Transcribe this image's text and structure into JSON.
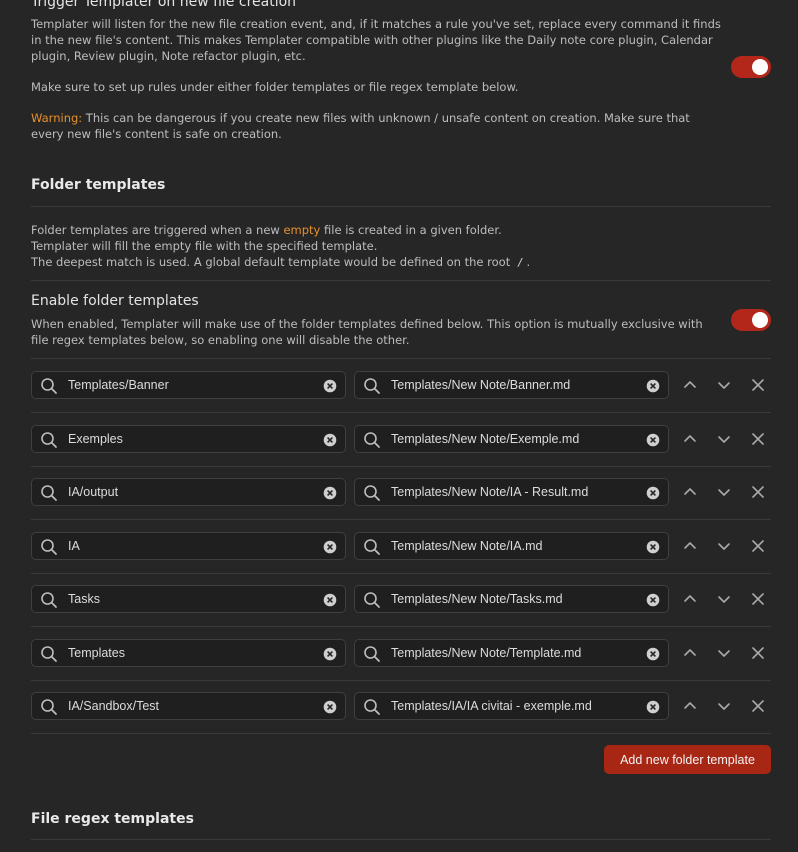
{
  "trigger": {
    "title": "Trigger Templater on new file creation",
    "desc1": "Templater will listen for the new file creation event, and, if it matches a rule you've set, replace every command it finds in the new file's content. This makes Templater compatible with other plugins like the Daily note core plugin, Calendar plugin, Review plugin, Note refactor plugin, etc.",
    "desc2": "Make sure to set up rules under either folder templates or file regex template below.",
    "warning_label": "Warning:",
    "warning_text": " This can be dangerous if you create new files with unknown / unsafe content on creation. Make sure that every new file's content is safe on creation.",
    "enabled": true
  },
  "folder_templates": {
    "heading": "Folder templates",
    "desc_line1_a": "Folder templates are triggered when a new ",
    "desc_line1_em": "empty",
    "desc_line1_b": " file is created in a given folder.",
    "desc_line2": "Templater will fill the empty file with the specified template.",
    "desc_line3_a": "The deepest match is used. A global default template would be defined on the root ",
    "desc_line3_code": "/",
    "desc_line3_b": ".",
    "enable_title": "Enable folder templates",
    "enable_desc": "When enabled, Templater will make use of the folder templates defined below. This option is mutually exclusive with file regex templates below, so enabling one will disable the other.",
    "enabled": true,
    "rows": [
      {
        "folder": "Templates/Banner",
        "template": "Templates/New Note/Banner.md"
      },
      {
        "folder": "Exemples",
        "template": "Templates/New Note/Exemple.md"
      },
      {
        "folder": "IA/output",
        "template": "Templates/New Note/IA - Result.md"
      },
      {
        "folder": "IA",
        "template": "Templates/New Note/IA.md"
      },
      {
        "folder": "Tasks",
        "template": "Templates/New Note/Tasks.md"
      },
      {
        "folder": "Templates",
        "template": "Templates/New Note/Template.md"
      },
      {
        "folder": "IA/Sandbox/Test",
        "template": "Templates/IA/IA civitai - exemple.md"
      }
    ],
    "add_button": "Add new folder template"
  },
  "file_regex": {
    "heading": "File regex templates"
  },
  "colors": {
    "accent": "#a82614",
    "warning": "#e8902b",
    "background": "#262626"
  }
}
